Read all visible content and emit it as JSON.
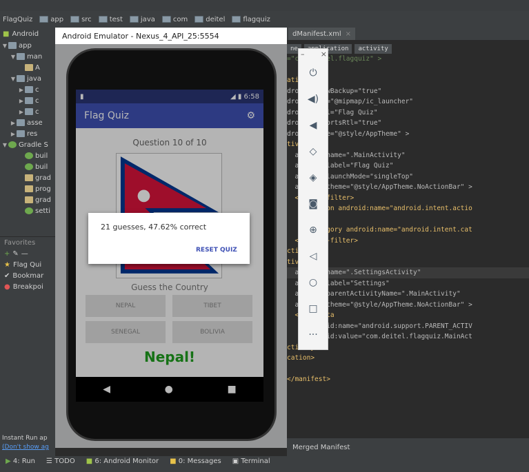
{
  "ide": {
    "breadcrumbs": [
      "FlagQuiz",
      "app",
      "src",
      "test",
      "java",
      "com",
      "deitel",
      "flagquiz"
    ],
    "project_view": "Android",
    "tree": [
      {
        "label": "app",
        "tri": "▼",
        "icon": "folder"
      },
      {
        "label": "man",
        "tri": "▼",
        "icon": "folder"
      },
      {
        "label": "A",
        "tri": "",
        "icon": "file"
      },
      {
        "label": "java",
        "tri": "▼",
        "icon": "folder"
      },
      {
        "label": "c",
        "tri": "▶",
        "icon": "folder"
      },
      {
        "label": "c",
        "tri": "▶",
        "icon": "folder"
      },
      {
        "label": "c",
        "tri": "▶",
        "icon": "folder"
      },
      {
        "label": "asse",
        "tri": "▶",
        "icon": "folder"
      },
      {
        "label": "res",
        "tri": "▶",
        "icon": "folder"
      },
      {
        "label": "Gradle S",
        "tri": "▼",
        "icon": "gradle"
      },
      {
        "label": "buil",
        "tri": "",
        "icon": "gradle"
      },
      {
        "label": "buil",
        "tri": "",
        "icon": "gradle"
      },
      {
        "label": "grad",
        "tri": "",
        "icon": "file"
      },
      {
        "label": "prog",
        "tri": "",
        "icon": "file"
      },
      {
        "label": "grad",
        "tri": "",
        "icon": "file"
      },
      {
        "label": "setti",
        "tri": "",
        "icon": "gradle"
      }
    ],
    "favorites_title": "Favorites",
    "favorites": [
      "Flag Qui",
      "Bookmar",
      "Breakpoi"
    ],
    "instant_run_line1": "Instant Run ap",
    "instant_run_link": "(Don't show ag",
    "editor_tab": "dManifest.xml",
    "chips": [
      "ne",
      "application",
      "activity"
    ],
    "code_lines": [
      {
        "t": "=\"com.deitel.flagquiz\" >",
        "c": "val"
      },
      {
        "t": "",
        "c": "at"
      },
      {
        "t": "ation",
        "c": "kw"
      },
      {
        "t": "droid:allowBackup=\"true\"",
        "c": "at"
      },
      {
        "t": "droid:icon=\"@mipmap/ic_launcher\"",
        "c": "at"
      },
      {
        "t": "droid:label=\"Flag Quiz\"",
        "c": "at"
      },
      {
        "t": "droid:supportsRtl=\"true\"",
        "c": "at"
      },
      {
        "t": "droid:theme=\"@style/AppTheme\" >",
        "c": "at"
      },
      {
        "t": "tivity",
        "c": "kw"
      },
      {
        "t": "  android:name=\".MainActivity\"",
        "c": "at"
      },
      {
        "t": "  android:label=\"Flag Quiz\"",
        "c": "at"
      },
      {
        "t": "  android:launchMode=\"singleTop\"",
        "c": "at"
      },
      {
        "t": "  android:theme=\"@style/AppTheme.NoActionBar\" >",
        "c": "at"
      },
      {
        "t": "  <intent-filter>",
        "c": "kw"
      },
      {
        "t": "     <action android:name=\"android.intent.actio",
        "c": "kw"
      },
      {
        "t": "",
        "c": "at"
      },
      {
        "t": "     <category android:name=\"android.intent.cat",
        "c": "kw"
      },
      {
        "t": "  </intent-filter>",
        "c": "kw"
      },
      {
        "t": "ctivity>",
        "c": "kw"
      },
      {
        "t": "tivity",
        "c": "kw"
      },
      {
        "t": "  android:name=\".SettingsActivity\"",
        "c": "at"
      },
      {
        "t": "  android:label=\"Settings\"",
        "c": "at"
      },
      {
        "t": "  android:parentActivityName=\".MainActivity\"",
        "c": "at"
      },
      {
        "t": "  android:theme=\"@style/AppTheme.NoActionBar\" >",
        "c": "at"
      },
      {
        "t": "  <meta-data",
        "c": "kw"
      },
      {
        "t": "     android:name=\"android.support.PARENT_ACTIV",
        "c": "at"
      },
      {
        "t": "     android:value=\"com.deitel.flagquiz.MainAct",
        "c": "at"
      },
      {
        "t": "ctivity>",
        "c": "kw"
      },
      {
        "t": "cation>",
        "c": "kw"
      },
      {
        "t": "",
        "c": "at"
      },
      {
        "t": "</manifest>",
        "c": "kw"
      }
    ],
    "merged_manifest": "Merged Manifest",
    "bottom_tools": [
      "4: Run",
      "TODO",
      "6: Android Monitor",
      "0: Messages",
      "Terminal"
    ]
  },
  "emulator": {
    "title": "Android Emulator - Nexus_4_API_25:5554",
    "clock": "6:58",
    "app_title": "Flag Quiz",
    "question": "Question 10 of 10",
    "guess_label": "Guess the Country",
    "answers": [
      "NEPAL",
      "TIBET",
      "SENEGAL",
      "BOLIVIA"
    ],
    "result": "Nepal!",
    "dialog_message": "21 guesses, 47.62% correct",
    "dialog_button": "RESET QUIZ",
    "panel_controls": [
      "power-icon",
      "volume-up-icon",
      "volume-down-icon",
      "rotate-left-icon",
      "rotate-right-icon",
      "camera-icon",
      "zoom-icon",
      "back-icon",
      "home-icon",
      "overview-icon",
      "more-icon"
    ]
  },
  "colors": {
    "app_bar": "#3f51b5",
    "status_bar": "#2a3575",
    "result": "#1f9e1f",
    "flag_red": "#dc143c",
    "flag_blue": "#003893"
  }
}
